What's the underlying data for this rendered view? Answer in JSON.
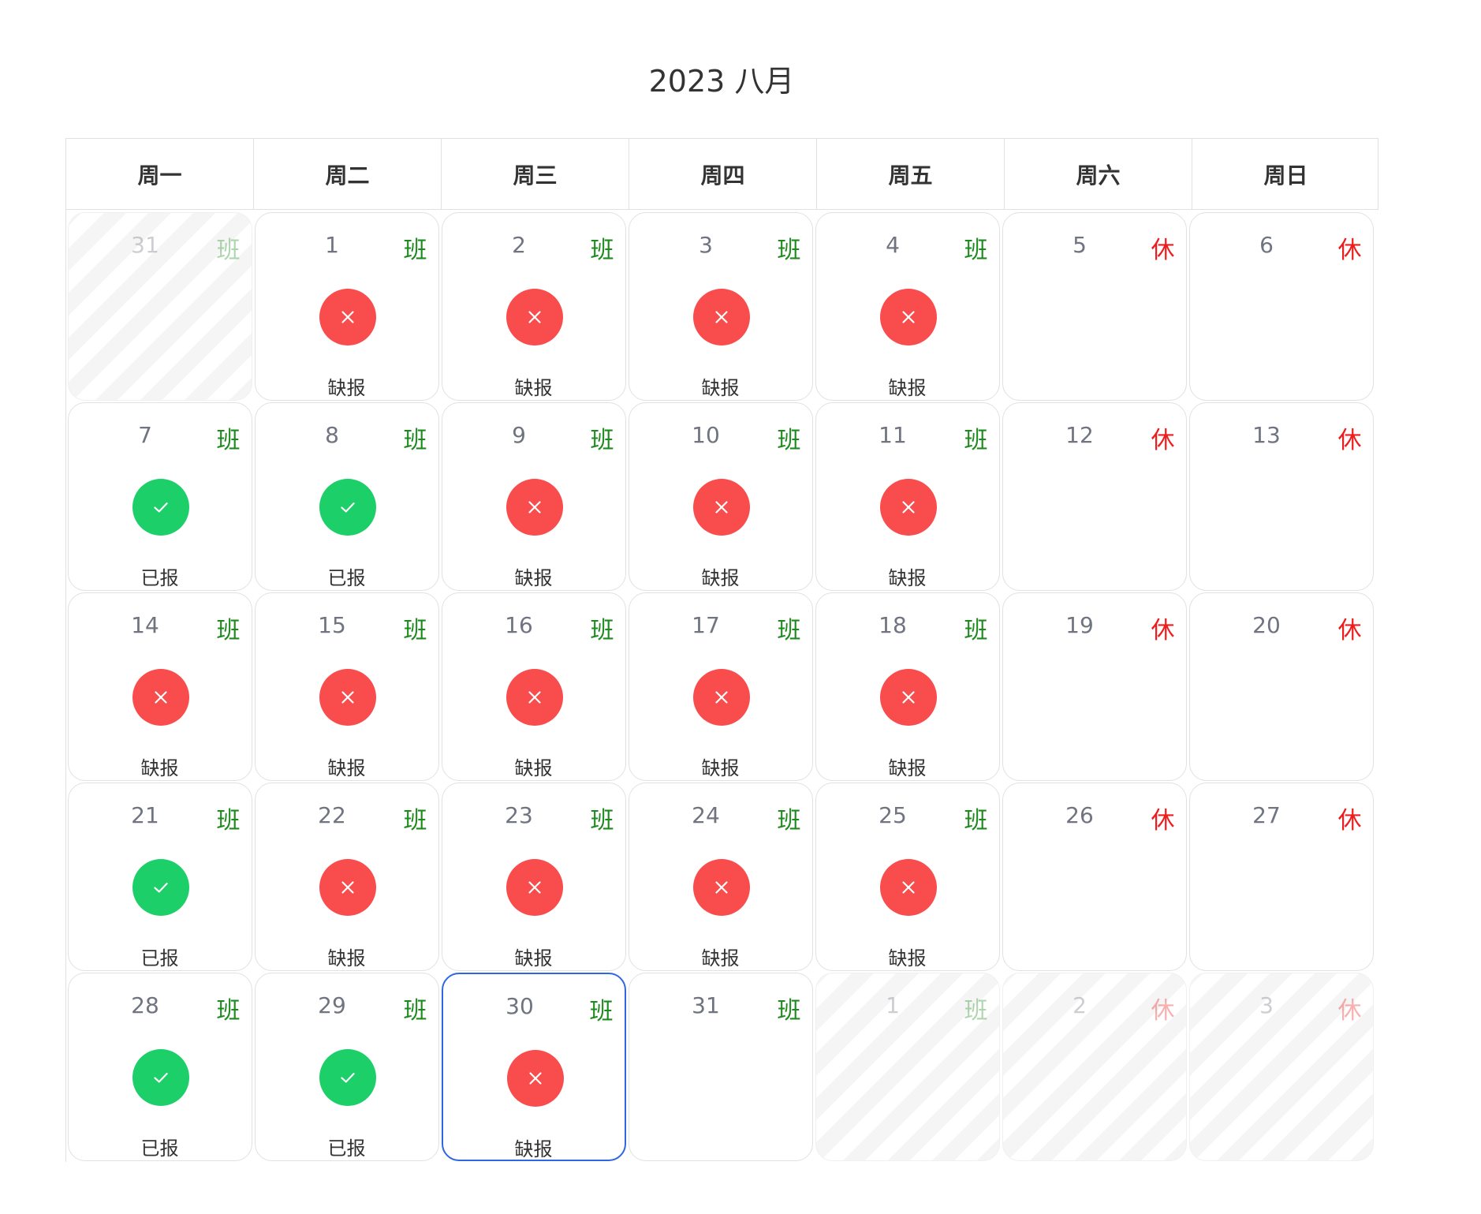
{
  "calendar": {
    "title": "2023 八月",
    "weekdays": [
      "周一",
      "周二",
      "周三",
      "周四",
      "周五",
      "周六",
      "周日"
    ],
    "status_labels": {
      "reported": "已报",
      "missing": "缺报"
    },
    "tags": {
      "work": "班",
      "rest": "休"
    },
    "colors": {
      "work_tag": "#1d8a1d",
      "rest_tag": "#ee1c1c",
      "missing": "#f94c4c",
      "reported": "#1ccf69",
      "selected_border": "#2e66e3"
    },
    "days": [
      {
        "day": "31",
        "tag": "班",
        "tag_type": "work",
        "out_of_month": true,
        "status": null
      },
      {
        "day": "1",
        "tag": "班",
        "tag_type": "work",
        "out_of_month": false,
        "status": "missing",
        "status_label": "缺报"
      },
      {
        "day": "2",
        "tag": "班",
        "tag_type": "work",
        "out_of_month": false,
        "status": "missing",
        "status_label": "缺报"
      },
      {
        "day": "3",
        "tag": "班",
        "tag_type": "work",
        "out_of_month": false,
        "status": "missing",
        "status_label": "缺报"
      },
      {
        "day": "4",
        "tag": "班",
        "tag_type": "work",
        "out_of_month": false,
        "status": "missing",
        "status_label": "缺报"
      },
      {
        "day": "5",
        "tag": "休",
        "tag_type": "rest",
        "out_of_month": false,
        "status": null
      },
      {
        "day": "6",
        "tag": "休",
        "tag_type": "rest",
        "out_of_month": false,
        "status": null
      },
      {
        "day": "7",
        "tag": "班",
        "tag_type": "work",
        "out_of_month": false,
        "status": "reported",
        "status_label": "已报"
      },
      {
        "day": "8",
        "tag": "班",
        "tag_type": "work",
        "out_of_month": false,
        "status": "reported",
        "status_label": "已报"
      },
      {
        "day": "9",
        "tag": "班",
        "tag_type": "work",
        "out_of_month": false,
        "status": "missing",
        "status_label": "缺报"
      },
      {
        "day": "10",
        "tag": "班",
        "tag_type": "work",
        "out_of_month": false,
        "status": "missing",
        "status_label": "缺报"
      },
      {
        "day": "11",
        "tag": "班",
        "tag_type": "work",
        "out_of_month": false,
        "status": "missing",
        "status_label": "缺报"
      },
      {
        "day": "12",
        "tag": "休",
        "tag_type": "rest",
        "out_of_month": false,
        "status": null
      },
      {
        "day": "13",
        "tag": "休",
        "tag_type": "rest",
        "out_of_month": false,
        "status": null
      },
      {
        "day": "14",
        "tag": "班",
        "tag_type": "work",
        "out_of_month": false,
        "status": "missing",
        "status_label": "缺报"
      },
      {
        "day": "15",
        "tag": "班",
        "tag_type": "work",
        "out_of_month": false,
        "status": "missing",
        "status_label": "缺报"
      },
      {
        "day": "16",
        "tag": "班",
        "tag_type": "work",
        "out_of_month": false,
        "status": "missing",
        "status_label": "缺报"
      },
      {
        "day": "17",
        "tag": "班",
        "tag_type": "work",
        "out_of_month": false,
        "status": "missing",
        "status_label": "缺报"
      },
      {
        "day": "18",
        "tag": "班",
        "tag_type": "work",
        "out_of_month": false,
        "status": "missing",
        "status_label": "缺报"
      },
      {
        "day": "19",
        "tag": "休",
        "tag_type": "rest",
        "out_of_month": false,
        "status": null
      },
      {
        "day": "20",
        "tag": "休",
        "tag_type": "rest",
        "out_of_month": false,
        "status": null
      },
      {
        "day": "21",
        "tag": "班",
        "tag_type": "work",
        "out_of_month": false,
        "status": "reported",
        "status_label": "已报"
      },
      {
        "day": "22",
        "tag": "班",
        "tag_type": "work",
        "out_of_month": false,
        "status": "missing",
        "status_label": "缺报"
      },
      {
        "day": "23",
        "tag": "班",
        "tag_type": "work",
        "out_of_month": false,
        "status": "missing",
        "status_label": "缺报"
      },
      {
        "day": "24",
        "tag": "班",
        "tag_type": "work",
        "out_of_month": false,
        "status": "missing",
        "status_label": "缺报"
      },
      {
        "day": "25",
        "tag": "班",
        "tag_type": "work",
        "out_of_month": false,
        "status": "missing",
        "status_label": "缺报"
      },
      {
        "day": "26",
        "tag": "休",
        "tag_type": "rest",
        "out_of_month": false,
        "status": null
      },
      {
        "day": "27",
        "tag": "休",
        "tag_type": "rest",
        "out_of_month": false,
        "status": null
      },
      {
        "day": "28",
        "tag": "班",
        "tag_type": "work",
        "out_of_month": false,
        "status": "reported",
        "status_label": "已报"
      },
      {
        "day": "29",
        "tag": "班",
        "tag_type": "work",
        "out_of_month": false,
        "status": "reported",
        "status_label": "已报"
      },
      {
        "day": "30",
        "tag": "班",
        "tag_type": "work",
        "out_of_month": false,
        "status": "missing",
        "status_label": "缺报",
        "selected": true
      },
      {
        "day": "31",
        "tag": "班",
        "tag_type": "work",
        "out_of_month": false,
        "status": null
      },
      {
        "day": "1",
        "tag": "班",
        "tag_type": "work",
        "out_of_month": true,
        "status": null
      },
      {
        "day": "2",
        "tag": "休",
        "tag_type": "rest",
        "out_of_month": true,
        "status": null
      },
      {
        "day": "3",
        "tag": "休",
        "tag_type": "rest",
        "out_of_month": true,
        "status": null
      }
    ]
  }
}
